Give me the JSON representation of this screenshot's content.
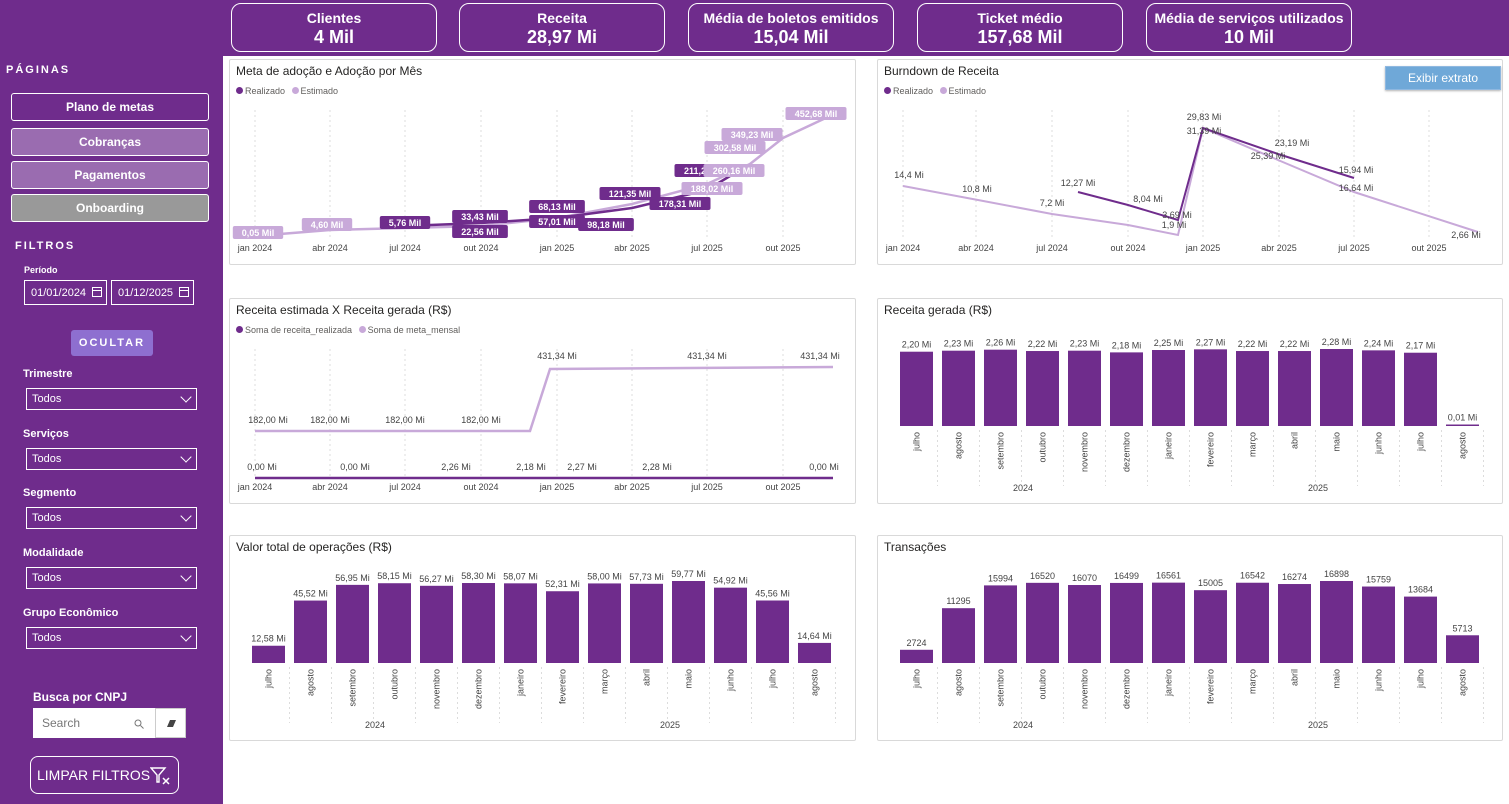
{
  "kpis": [
    {
      "title": "Clientes",
      "value": "4 Mil"
    },
    {
      "title": "Receita",
      "value": "28,97 Mi"
    },
    {
      "title": "Média de boletos emitidos",
      "value": "15,04 Mil"
    },
    {
      "title": "Ticket médio",
      "value": "157,68 Mil"
    },
    {
      "title": "Média de serviços utilizados",
      "value": "10 Mil"
    }
  ],
  "sidebar": {
    "pages_title": "PÁGINAS",
    "pages": [
      "Plano de metas",
      "Cobranças",
      "Pagamentos",
      "Onboarding"
    ],
    "filters_title": "FILTROS",
    "period_label": "Período",
    "date_start": "01/01/2024",
    "date_end": "01/12/2025",
    "hide_label": "OCULTAR",
    "filters": [
      {
        "label": "Trimestre",
        "value": "Todos"
      },
      {
        "label": "Serviços",
        "value": "Todos"
      },
      {
        "label": "Segmento",
        "value": "Todos"
      },
      {
        "label": "Modalidade",
        "value": "Todos"
      },
      {
        "label": "Grupo Econômico",
        "value": "Todos"
      }
    ],
    "cnpj_label": "Busca por CNPJ",
    "search_placeholder": "Search",
    "clear_label": "LIMPAR FILTROS"
  },
  "colors": {
    "primary": "#6f2c8c",
    "light": "#c8a9d9",
    "button_grey": "#999999",
    "button_mid": "#9a6cb0",
    "extrato": "#6fa8d8"
  },
  "extrato_button": "Exibir extrato",
  "axis_dates": [
    "jan 2024",
    "abr 2024",
    "jul 2024",
    "out 2024",
    "jan 2025",
    "abr 2025",
    "jul 2025",
    "out 2025"
  ],
  "month_names": [
    "julho",
    "agosto",
    "setembro",
    "outubro",
    "novembro",
    "dezembro",
    "janeiro",
    "fevereiro",
    "março",
    "abril",
    "maio",
    "junho",
    "julho",
    "agosto"
  ],
  "years": [
    "2024",
    "2025"
  ],
  "chart_data": [
    {
      "title": "Meta de adoção e Adoção por Mês",
      "type": "line",
      "legend": [
        "Realizado",
        "Estimado"
      ],
      "series": [
        {
          "name": "Realizado",
          "points": [
            [
              "jul 2024",
              "5,76 Mil"
            ],
            [
              "set 2024",
              "33,43 Mil"
            ],
            [
              "out 2024",
              "22,56 Mil"
            ],
            [
              "jan 2025",
              "68,13 Mil"
            ],
            [
              "jan 2025",
              "57,01 Mil"
            ],
            [
              "mar 2025",
              "98,18 Mil"
            ],
            [
              "abr 2025",
              "121,35 Mil"
            ],
            [
              "jun 2025",
              "178,31 Mil"
            ],
            [
              "jul 2025",
              "211,25 Mil"
            ]
          ]
        },
        {
          "name": "Estimado",
          "points": [
            [
              "jan 2024",
              "0,05 Mil"
            ],
            [
              "jun 2024",
              "4,60 Mil"
            ],
            [
              "jul 2025",
              "188,02 Mil"
            ],
            [
              "ago 2025",
              "260,16 Mil"
            ],
            [
              "ago 2025",
              "302,58 Mil"
            ],
            [
              "set 2025",
              "349,23 Mil"
            ],
            [
              "nov 2025",
              "452,68 Mil"
            ]
          ]
        }
      ]
    },
    {
      "title": "Burndown de Receita",
      "type": "line",
      "legend": [
        "Realizado",
        "Estimado"
      ],
      "labels": [
        "14,4 Mi",
        "10,8 Mi",
        "7,2 Mi",
        "12,27 Mi",
        "8,04 Mi",
        "3,69 Mi",
        "1,9 Mi",
        "29,83 Mi",
        "31,39 Mi",
        "23,19 Mi",
        "25,39 Mi",
        "15,94 Mi",
        "16,64 Mi",
        "2,66 Mi"
      ]
    },
    {
      "title": "Receita estimada X Receita gerada (R$)",
      "type": "line",
      "legend": [
        "Soma de receita_realizada",
        "Soma de meta_mensal"
      ],
      "meta_labels": [
        "182,00 Mi",
        "182,00 Mi",
        "182,00 Mi",
        "182,00 Mi",
        "431,34 Mi",
        "431,34 Mi",
        "431,34 Mi"
      ],
      "real_labels": [
        "0,00 Mi",
        "0,00 Mi",
        "2,26 Mi",
        "2,18 Mi",
        "2,27 Mi",
        "2,28 Mi",
        "0,00 Mi"
      ]
    },
    {
      "title": "Receita gerada (R$)",
      "type": "bar",
      "values": [
        2.2,
        2.23,
        2.26,
        2.22,
        2.23,
        2.18,
        2.25,
        2.27,
        2.22,
        2.22,
        2.28,
        2.24,
        2.17,
        0.01
      ],
      "labels": [
        "2,20 Mi",
        "2,23 Mi",
        "2,26 Mi",
        "2,22 Mi",
        "2,23 Mi",
        "2,18 Mi",
        "2,25 Mi",
        "2,27 Mi",
        "2,22 Mi",
        "2,22 Mi",
        "2,28 Mi",
        "2,24 Mi",
        "2,17 Mi",
        "0,01 Mi"
      ]
    },
    {
      "title": "Valor total de operações (R$)",
      "type": "bar",
      "values": [
        12.58,
        45.52,
        56.95,
        58.15,
        56.27,
        58.3,
        58.07,
        52.31,
        58.0,
        57.73,
        59.77,
        54.92,
        45.56,
        14.64
      ],
      "labels": [
        "12,58 Mi",
        "45,52 Mi",
        "56,95 Mi",
        "58,15 Mi",
        "56,27 Mi",
        "58,30 Mi",
        "58,07 Mi",
        "52,31 Mi",
        "58,00 Mi",
        "57,73 Mi",
        "59,77 Mi",
        "54,92 Mi",
        "45,56 Mi",
        "14,64 Mi"
      ]
    },
    {
      "title": "Transações",
      "type": "bar",
      "values": [
        2724,
        11295,
        15994,
        16520,
        16070,
        16499,
        16561,
        15005,
        16542,
        16274,
        16898,
        15759,
        13684,
        5713
      ],
      "labels": [
        "2724",
        "11295",
        "15994",
        "16520",
        "16070",
        "16499",
        "16561",
        "15005",
        "16542",
        "16274",
        "16898",
        "15759",
        "13684",
        "5713"
      ]
    }
  ]
}
